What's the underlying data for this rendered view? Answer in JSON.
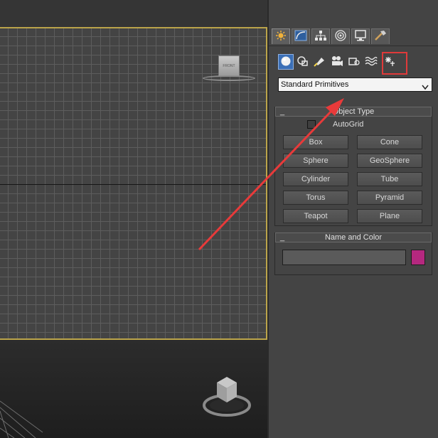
{
  "viewports": {
    "top_cube_label": "FRONT"
  },
  "command_panel": {
    "tabs": [
      {
        "icon": "create-sun-icon",
        "active": true
      },
      {
        "icon": "modify-curve-icon",
        "active": false
      },
      {
        "icon": "hierarchy-icon",
        "active": false
      },
      {
        "icon": "motion-icon",
        "active": false
      },
      {
        "icon": "display-monitor-icon",
        "active": false
      },
      {
        "icon": "utilities-hammer-icon",
        "active": false
      }
    ],
    "sub_icons": [
      "geometry-sphere-icon",
      "shapes-icon",
      "lights-icon",
      "cameras-icon",
      "helpers-icon",
      "space-warps-icon",
      "systems-icon"
    ],
    "dropdown_value": "Standard Primitives",
    "object_type": {
      "title": "Object Type",
      "toggle": "_",
      "autogrid_label": "AutoGrid",
      "buttons": [
        "Box",
        "Cone",
        "Sphere",
        "GeoSphere",
        "Cylinder",
        "Tube",
        "Torus",
        "Pyramid",
        "Teapot",
        "Plane"
      ]
    },
    "name_and_color": {
      "title": "Name and Color",
      "toggle": "_",
      "name_value": "",
      "color": "#b5287f"
    }
  },
  "colors": {
    "active_viewport_border": "#bba44a",
    "annotation_red": "#e03a3a",
    "active_tab_blue": "#3b6fb6"
  }
}
